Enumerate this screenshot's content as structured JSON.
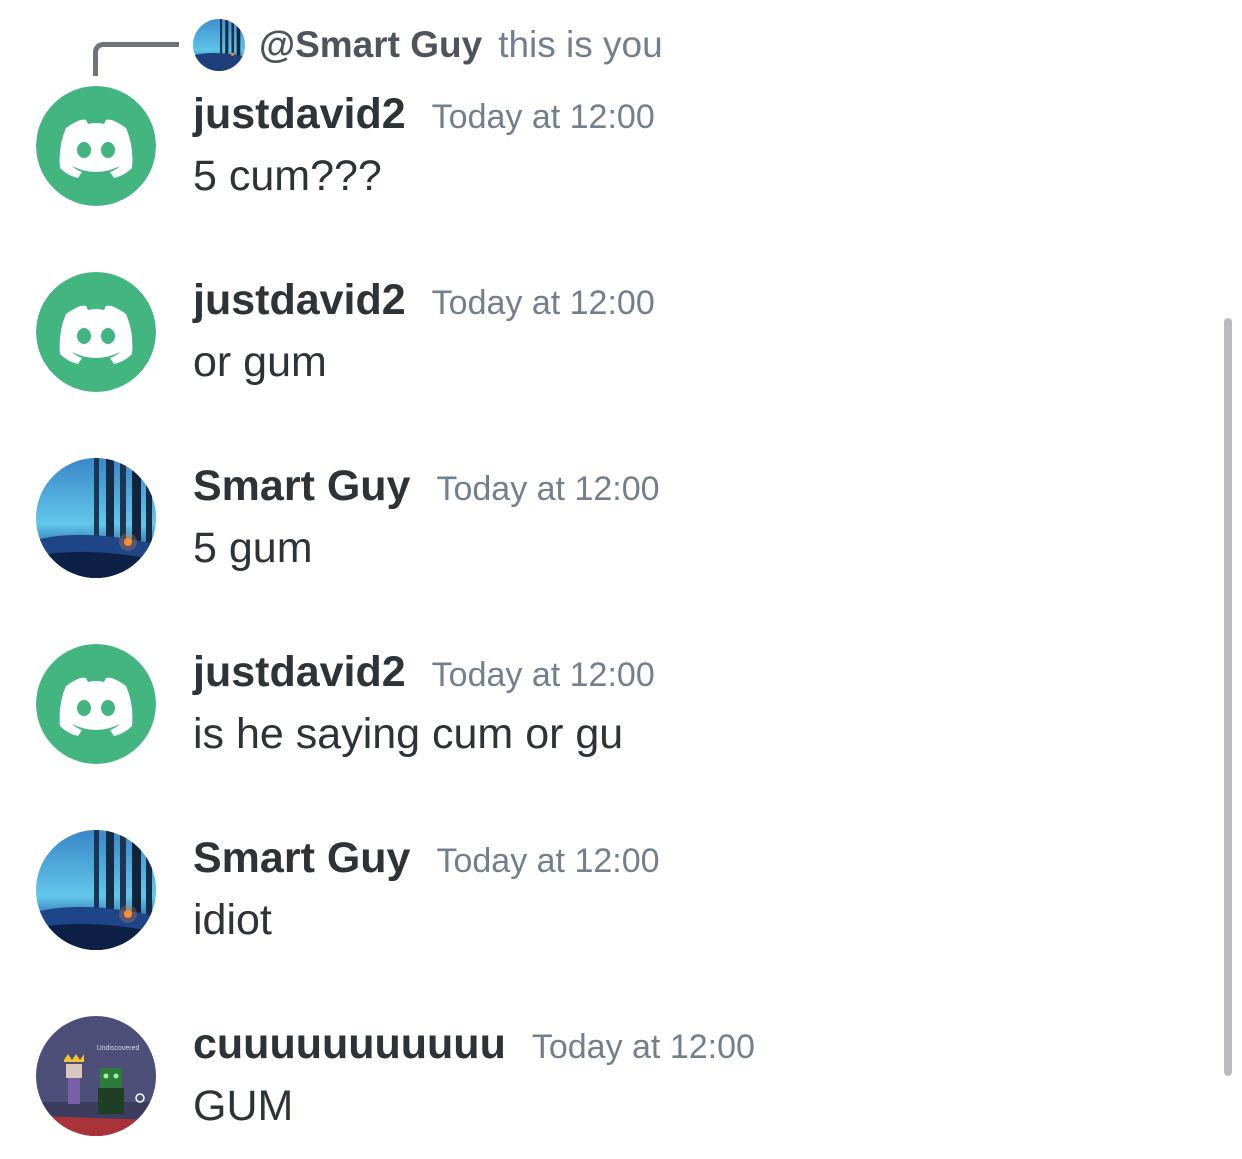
{
  "reply": {
    "mention": "@Smart Guy",
    "note": "this is you"
  },
  "messages": [
    {
      "author": "justdavid2",
      "timestamp": "Today at 12:00",
      "text": "5 cum???",
      "avatar": "discord-logo-icon"
    },
    {
      "author": "justdavid2",
      "timestamp": "Today at 12:00",
      "text": "or gum",
      "avatar": "discord-logo-icon"
    },
    {
      "author": "Smart Guy",
      "timestamp": "Today at 12:00",
      "text": "5 gum",
      "avatar": "forest-campfire-avatar"
    },
    {
      "author": "justdavid2",
      "timestamp": "Today at 12:00",
      "text": "is he saying cum or gu",
      "avatar": "discord-logo-icon"
    },
    {
      "author": "Smart Guy",
      "timestamp": "Today at 12:00",
      "text": "idiot",
      "avatar": "forest-campfire-avatar"
    },
    {
      "author": "cuuuuuuuuuuu",
      "timestamp": "Today at 12:00",
      "text": "GUM",
      "avatar": "game-characters-avatar",
      "avatar_caption": "Undiscovered"
    }
  ],
  "colors": {
    "discord_avatar_bg": "#43b581",
    "username": "#2e3338",
    "timestamp": "#747f8d",
    "scrollbar": "#b9bbbe"
  }
}
